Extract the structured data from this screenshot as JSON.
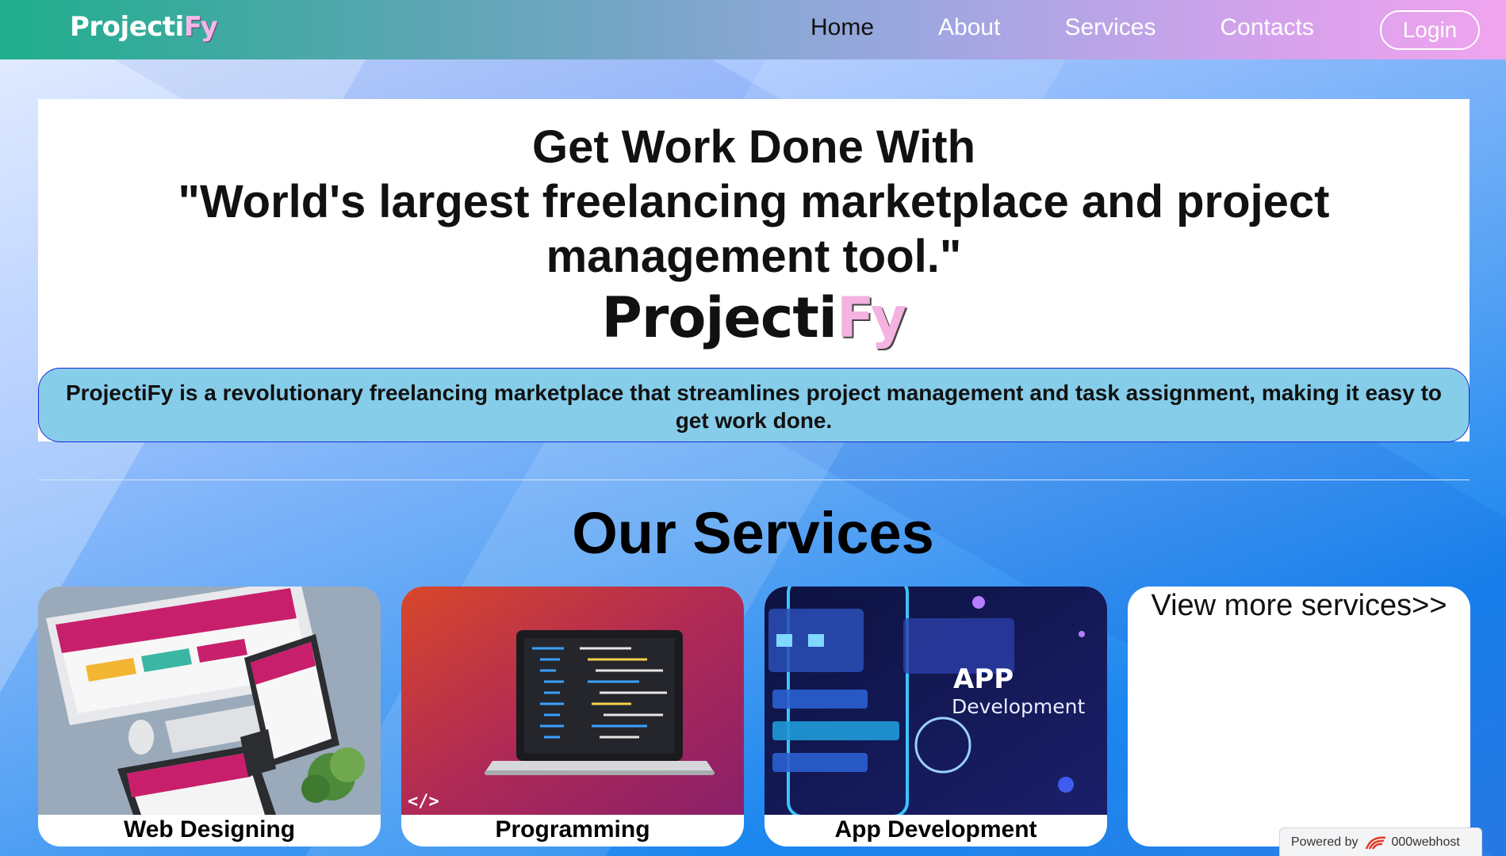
{
  "navbar": {
    "brand_main": "Projecti",
    "brand_accent": "Fy",
    "links": [
      {
        "label": "Home",
        "active": true
      },
      {
        "label": "About",
        "active": false
      },
      {
        "label": "Services",
        "active": false
      },
      {
        "label": "Contacts",
        "active": false
      }
    ],
    "login_label": "Login"
  },
  "hero": {
    "title_line1": "Get Work Done With",
    "title_line2": "\"World's largest freelancing marketplace and project",
    "title_line3": "management tool.\"",
    "brand_main": "Projecti",
    "brand_accent": "Fy",
    "description": "ProjectiFy is a revolutionary freelancing marketplace that streamlines project management and task assignment, making it easy to get work done."
  },
  "services": {
    "title": "Our Services",
    "cards": [
      {
        "label": "Web Designing",
        "image_icon": "devices-mockup-icon"
      },
      {
        "label": "Programming",
        "image_icon": "laptop-code-icon"
      },
      {
        "label": "App Development",
        "image_icon": "mobile-app-icon",
        "image_text_1": "APP",
        "image_text_2": "Development"
      }
    ],
    "more_label": "View more services>>"
  },
  "footer_badge": {
    "prefix": "Powered by",
    "provider": "000webhost"
  },
  "colors": {
    "nav_start": "#1fae8c",
    "nav_end": "#f0a4ee",
    "desc_bg": "#86cdea",
    "desc_border": "#1a2ad6",
    "brand_accent": "#f3b2df"
  }
}
